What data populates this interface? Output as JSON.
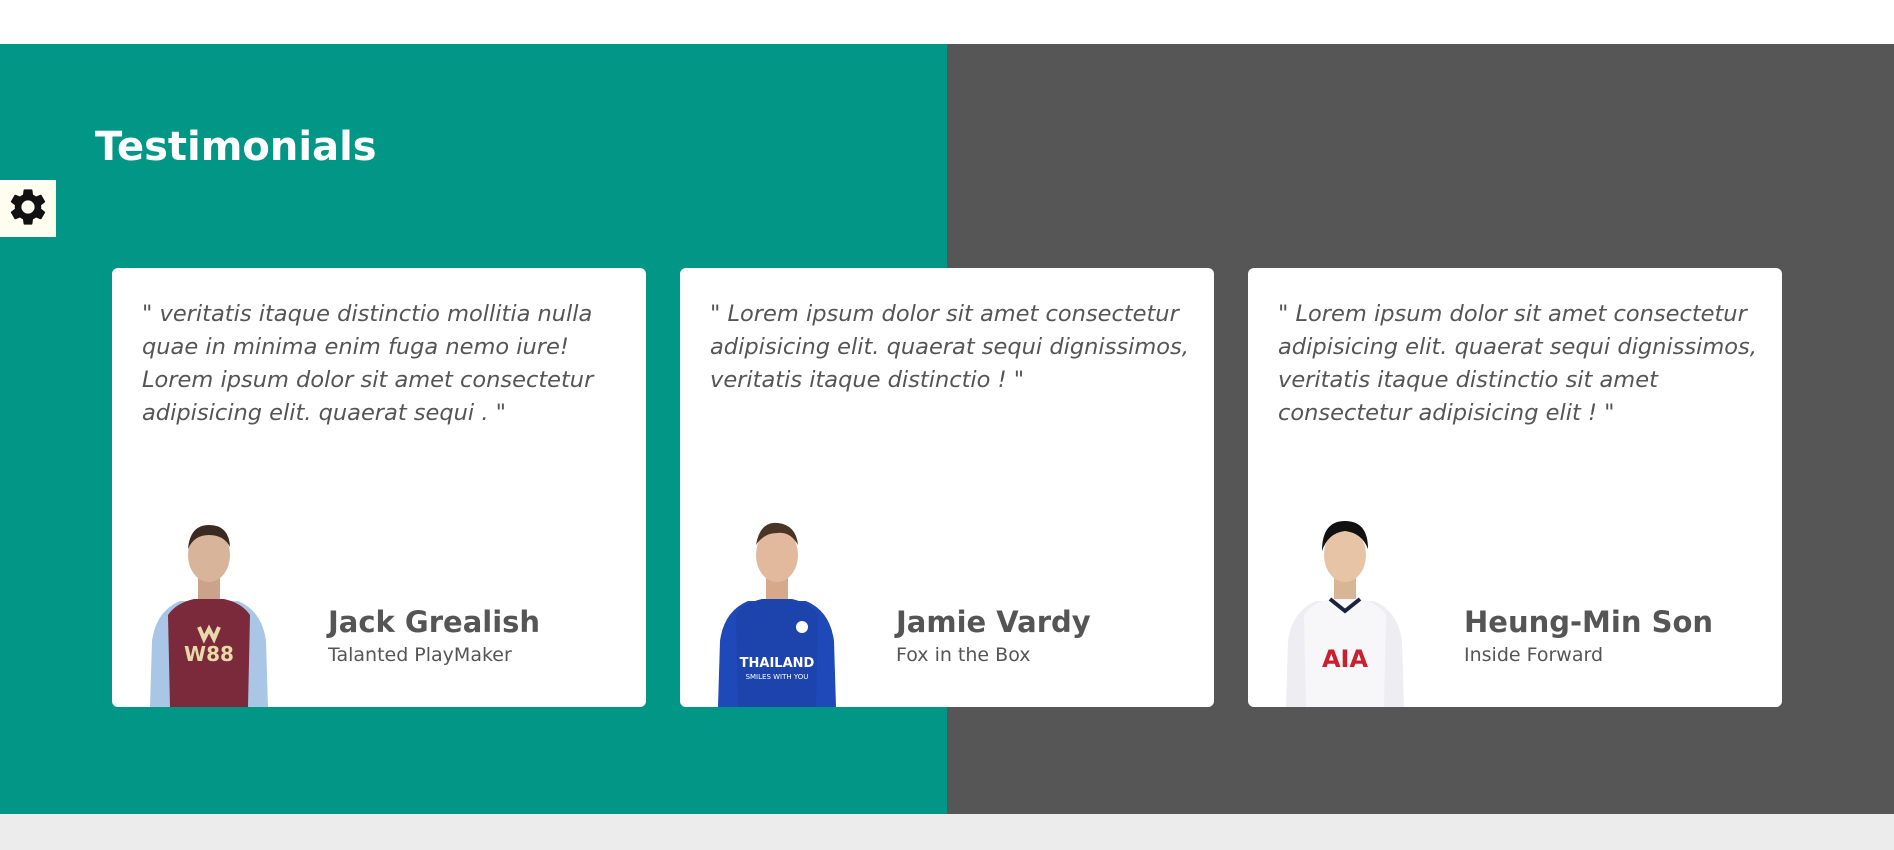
{
  "section": {
    "title": "Testimonials"
  },
  "settings": {
    "icon": "gear-icon"
  },
  "colors": {
    "left_bg": "#019686",
    "right_bg": "#565656",
    "card_bg": "#ffffff",
    "text": "#555555"
  },
  "testimonials": [
    {
      "quote": "\" veritatis itaque distinctio mollitia nulla quae in minima enim fuga nemo iure! Lorem ipsum dolor sit amet consectetur adipisicing elit. quaerat sequi . \"",
      "name": "Jack Grealish",
      "role": "Talanted PlayMaker",
      "kit": {
        "shirt": "#7a2a3a",
        "sleeve": "#a9c6e6",
        "sponsor": "W88",
        "sponsor_color": "#e8d9a8"
      }
    },
    {
      "quote": "\" Lorem ipsum dolor sit amet consectetur adipisicing elit. quaerat sequi dignissimos, veritatis itaque distinctio ! \"",
      "name": "Jamie Vardy",
      "role": "Fox in the Box",
      "kit": {
        "shirt": "#1f49b8",
        "sleeve": "#1f49b8",
        "sponsor": "THAILAND",
        "sponsor_color": "#ffffff"
      }
    },
    {
      "quote": "\" Lorem ipsum dolor sit amet consectetur adipisicing elit. quaerat sequi dignissimos, veritatis itaque distinctio sit amet consectetur adipisicing elit ! \"",
      "name": "Heung-Min Son",
      "role": "Inside Forward",
      "kit": {
        "shirt": "#f4f4f6",
        "sleeve": "#f4f4f6",
        "sponsor": "AIA",
        "sponsor_color": "#c8202f"
      }
    }
  ]
}
